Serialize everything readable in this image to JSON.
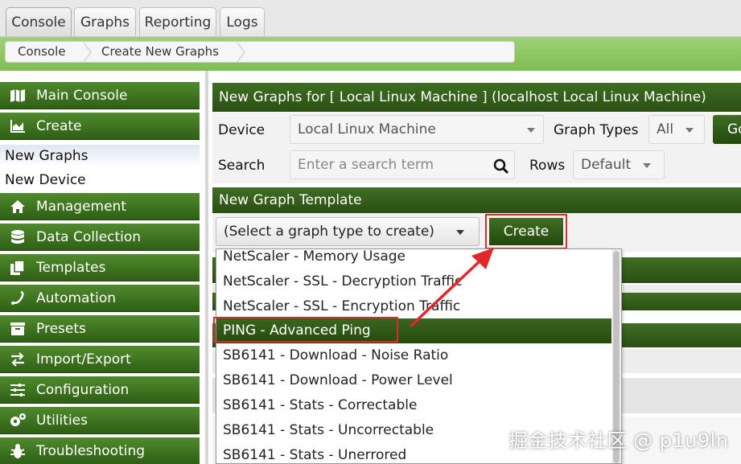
{
  "tabs": [
    {
      "label": "Console",
      "active": true
    },
    {
      "label": "Graphs"
    },
    {
      "label": "Reporting"
    },
    {
      "label": "Logs"
    }
  ],
  "breadcrumb": [
    "Console",
    "Create New Graphs"
  ],
  "sidebar": {
    "items": [
      {
        "label": "Main Console",
        "icon": "map-icon"
      },
      {
        "label": "Create",
        "icon": "chart-icon"
      },
      {
        "label": "New Graphs",
        "sub": true,
        "selected": true
      },
      {
        "label": "New Device",
        "sub": true
      },
      {
        "label": "Management",
        "icon": "home-icon"
      },
      {
        "label": "Data Collection",
        "icon": "database-icon"
      },
      {
        "label": "Templates",
        "icon": "copy-icon"
      },
      {
        "label": "Automation",
        "icon": "link-icon"
      },
      {
        "label": "Presets",
        "icon": "archive-icon"
      },
      {
        "label": "Import/Export",
        "icon": "exchange-icon"
      },
      {
        "label": "Configuration",
        "icon": "sliders-icon"
      },
      {
        "label": "Utilities",
        "icon": "cogs-icon"
      },
      {
        "label": "Troubleshooting",
        "icon": "bug-icon"
      }
    ]
  },
  "main": {
    "header": "New Graphs for [ Local Linux Machine ] (localhost Local Linux Machine)",
    "device_label": "Device",
    "device_value": "Local Linux Machine",
    "graph_types_label": "Graph Types",
    "graph_types_value": "All",
    "go_label": "Go",
    "search_label": "Search",
    "search_placeholder": "Enter a search term",
    "rows_label": "Rows",
    "rows_value": "Default",
    "template_header": "New Graph Template",
    "template_select": "(Select a graph type to create)",
    "create_label": "Create"
  },
  "dropdown": {
    "options": [
      "NetScaler - Memory Usage",
      "NetScaler - SSL - Decryption Traffic",
      "NetScaler - SSL - Encryption Traffic",
      "PING - Advanced Ping",
      "SB6141 - Download - Noise Ratio",
      "SB6141 - Download - Power Level",
      "SB6141 - Stats - Correctable",
      "SB6141 - Stats - Uncorrectable",
      "SB6141 - Stats - Unerrored"
    ],
    "highlighted": "PING - Advanced Ping"
  },
  "watermark": "掘金技术社区 @ p1u9ln",
  "colors": {
    "nav_green": "#3f6e23",
    "band_green": "#8cc65e",
    "annotation_red": "#e0272c"
  }
}
